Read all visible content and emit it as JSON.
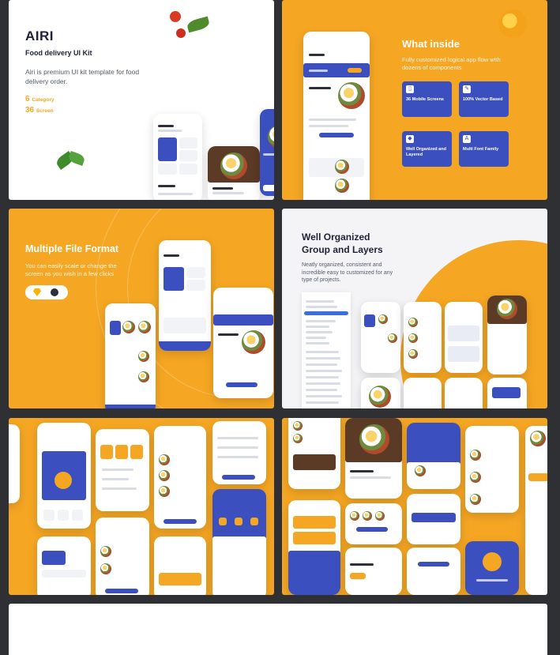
{
  "colors": {
    "accent": "#f5a623",
    "primary": "#3b4fbf",
    "background": "#2f3033"
  },
  "tile1": {
    "title": "AIRI",
    "subtitle": "Food delivery UI Kit",
    "description": "Airi is premium UI kit template for food delivery order.",
    "stat1_number": "6",
    "stat1_label": "Category",
    "stat2_number": "36",
    "stat2_label": "Screen"
  },
  "tile2": {
    "title": "What inside",
    "description": "Fully customized logical app flow with dozens of components",
    "features": [
      {
        "label": "36 Mobile Screens",
        "icon": "phone-icon"
      },
      {
        "label": "100% Vector Based",
        "icon": "pen-icon"
      },
      {
        "label": "Well Organized and Layered",
        "icon": "layers-icon"
      },
      {
        "label": "Multi Font Family",
        "icon": "font-icon"
      }
    ]
  },
  "tile3": {
    "title": "Multiple File Format",
    "description": "You can easily scale or change the screen as you wish in a few clicks",
    "icons": [
      "sketch-icon",
      "figma-icon"
    ]
  },
  "tile4": {
    "title_line1": "Well Organized",
    "title_line2": "Group and Layers",
    "description": "Neatly organized, consistent and incredible easy to customized for any type of projects."
  }
}
